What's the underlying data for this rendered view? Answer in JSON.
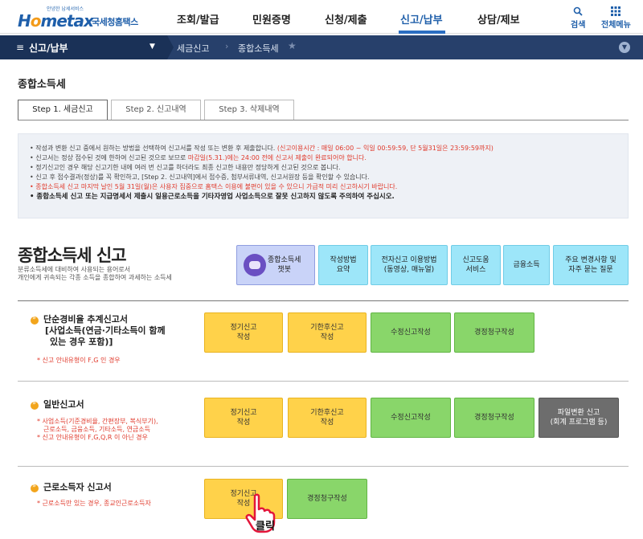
{
  "header": {
    "logo_sub": "안녕한 납세서비스",
    "logo_main_a": "H",
    "logo_main_o": "o",
    "logo_main_b": "metax",
    "logo_name": "국세청홈택스",
    "nav": [
      "조회/발급",
      "민원증명",
      "신청/제출",
      "신고/납부",
      "상담/제보"
    ],
    "active_nav": "신고/납부",
    "search_label": "검색",
    "menu_label": "전체메뉴"
  },
  "location": {
    "level1": "신고/납부",
    "level2": "세금신고",
    "level3": "종합소득세"
  },
  "page_title": "종합소득세",
  "tabs": [
    "Step 1. 세금신고",
    "Step 2. 신고내역",
    "Step 3. 삭제내역"
  ],
  "notice": {
    "l1a": "작성과 변환 신고 중에서 원하는 방법을 선택하여 신고서를 작성 또는 변환 후 제출합니다.",
    "l1b": "(신고이용시간 : 매일 06:00 ~ 익일 00:59:59, 단 5월31일은 23:59:59까지)",
    "l2a": "신고서는 정상 접수된 것에 한하여 신고된 것으로 보므로",
    "l2b": "마감일(5.31.)에는 24:00 전에 신고서 제출이 완료되어야 합니다.",
    "l3": "정기신고인 경우 해당 신고기한 내에 여러 번 신고를 하더라도 최종 신고한 내용만 정당하게 신고된 것으로 봅니다.",
    "l4": "신고 후 접수결과(정상)를 꼭 확인하고, [Step 2. 신고내역]에서 접수증, 첨부서류내역, 신고서원장 등을 확인할 수 있습니다.",
    "l5": "종합소득세 신고 마지막 날인 5월 31일(월)은 사용자 집중으로 홈택스 이용에 불편이 있을 수 있으니 가급적 미리 신고하시기 바랍니다.",
    "l6": "종합소득세 신고 또는 지급명세서 제출시 일용근로소득을 기타자영업 사업소득으로 잘못 신고하지 않도록 주의하여 주십시오."
  },
  "section": {
    "title": "종합소득세 신고",
    "desc1": "분류소득세에 대비하여 사용되는 용어로서",
    "desc2": "개인에게 귀속되는 각종 소득을 종합하여 과세하는 소득세",
    "chatbot_label1": "종합소득세",
    "chatbot_label2": "챗봇",
    "buttons": [
      {
        "l1": "작성방법",
        "l2": "요약"
      },
      {
        "l1": "전자신고 이용방법",
        "l2": "(동영상, 매뉴얼)"
      },
      {
        "l1": "신고도움",
        "l2": "서비스"
      },
      {
        "l1": "금융소득",
        "l2": ""
      },
      {
        "l1": "주요 변경사항 및",
        "l2": "자주 묻는 질문"
      }
    ]
  },
  "rows": {
    "r1": {
      "title1": "단순경비율 추계신고서",
      "title2": "[사업소득(연금·기타소득이 함께",
      "title3": "있는 경우 포함)]",
      "note1": "* 신고 안내유형이 F,G 인 경우",
      "btn1a": "정기신고",
      "btn1b": "작성",
      "btn2a": "기한후신고",
      "btn2b": "작성",
      "btn3": "수정신고작성",
      "btn4": "경정청구작성"
    },
    "r2": {
      "title1": "일반신고서",
      "note1": "* 사업소득(기준경비율, 간편장부, 복식부기),",
      "note2": "근로소득, 금융소득, 기타소득, 연금소득",
      "note3": "* 신고 안내유형이 F,G,Q,R 이 아닌 경우",
      "btn1a": "정기신고",
      "btn1b": "작성",
      "btn2a": "기한후신고",
      "btn2b": "작성",
      "btn3": "수정신고작성",
      "btn4": "경정청구작성",
      "btn5a": "파일변환 신고",
      "btn5b": "(회계 프로그램 등)"
    },
    "r3": {
      "title1": "근로소득자 신고서",
      "note1": "* 근로소득만 있는 경우, 종교인근로소득자",
      "btn1a": "정기신고",
      "btn1b": "작성",
      "btn2": "경정청구작성"
    }
  },
  "click_label": "클릭"
}
